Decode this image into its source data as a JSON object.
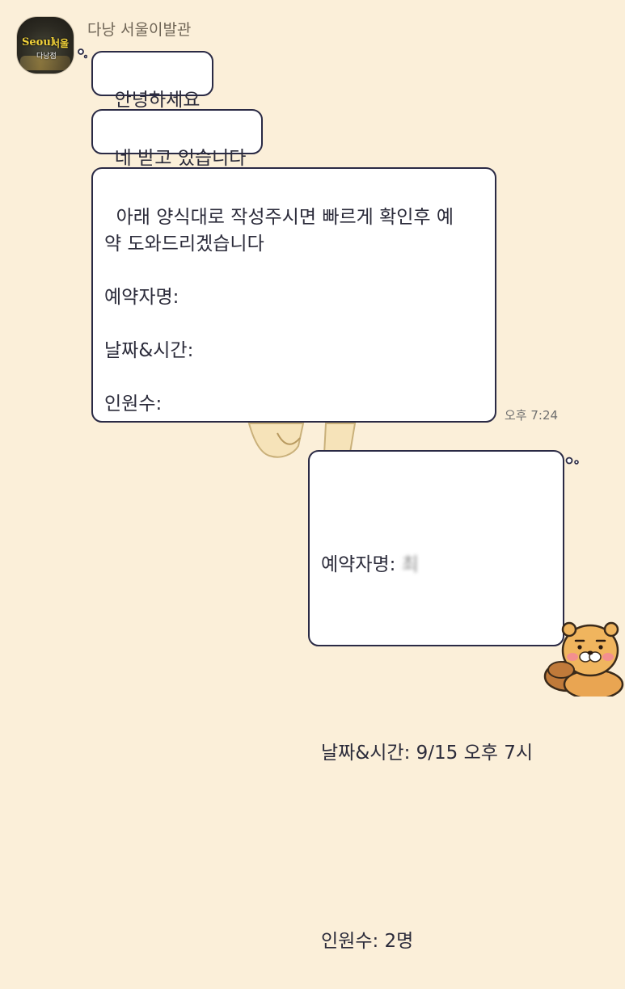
{
  "chat": {
    "sender_name": "다낭 서울이발관",
    "avatar": {
      "line1": "Seoul",
      "line2": "서울",
      "line3": "다낭점"
    },
    "incoming": [
      {
        "text": "안녕하세요"
      },
      {
        "text": "네 받고 있습니다"
      },
      {
        "text": "아래 양식대로 작성주시면 빠르게 확인후 예\n약 도와드리겠습니다\n\n예약자명:\n\n날짜&시간:\n\n인원수:"
      }
    ],
    "incoming_time": "오후 7:24",
    "outgoing": {
      "name_label": "예약자명: ",
      "name_value": "최 ",
      "date_line": "날짜&시간: 9/15 오후 7시",
      "count_line": "인원수: 2명"
    }
  },
  "stickers": {
    "background": "background-sticker",
    "corner": "ryan-character"
  },
  "colors": {
    "background": "#fbefd9",
    "bubble": "#ffffff",
    "bubble_border": "#2a2a45",
    "text": "#2b2b3a",
    "meta_text": "#6f6556"
  }
}
